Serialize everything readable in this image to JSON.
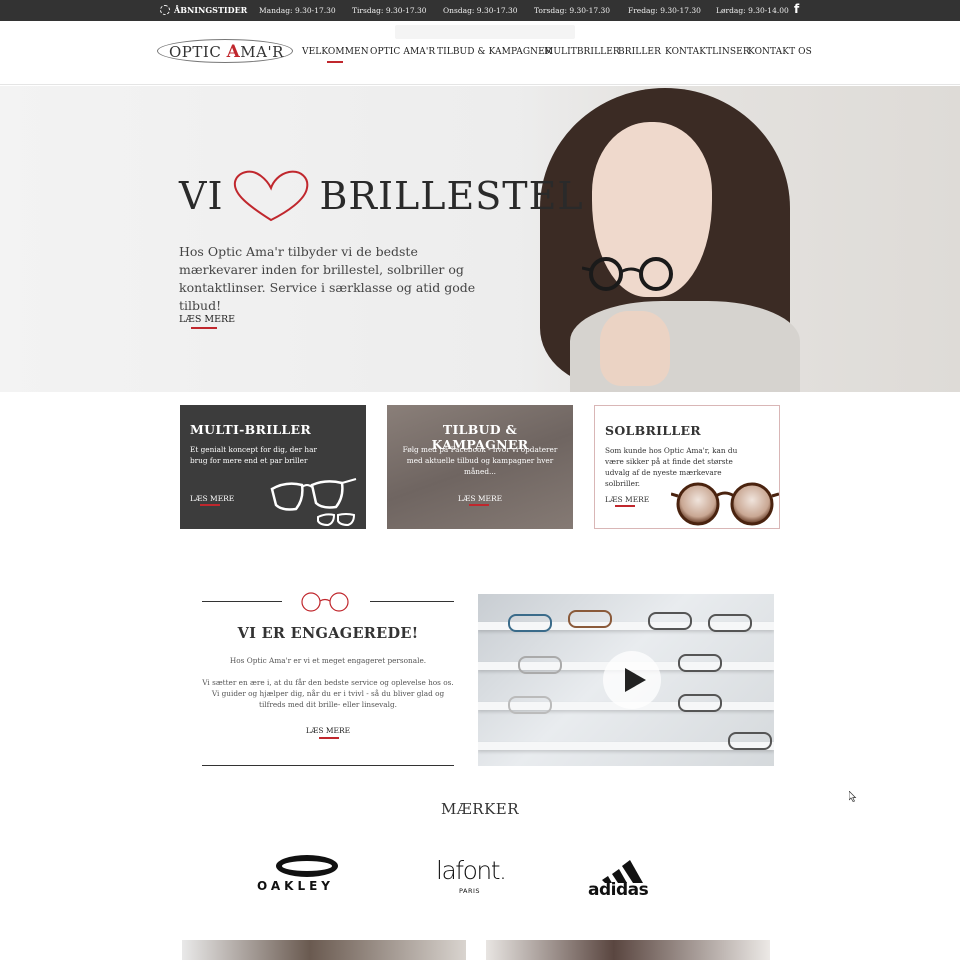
{
  "topbar": {
    "hours_label": "ÅBNINGSTIDER",
    "days": [
      {
        "text": "Mandag: 9.30-17.30"
      },
      {
        "text": "Tirsdag: 9.30-17.30"
      },
      {
        "text": "Onsdag: 9.30-17.30"
      },
      {
        "text": "Torsdag: 9.30-17.30"
      },
      {
        "text": "Fredag: 9.30-17.30"
      },
      {
        "text": "Lørdag: 9.30-14.00"
      }
    ],
    "facebook_icon": "f"
  },
  "logo": {
    "text_before": "OPTIC ",
    "text_accent": "A",
    "text_after": "MA'R"
  },
  "nav": {
    "items": [
      {
        "label": "VELKOMMEN"
      },
      {
        "label": "OPTIC AMA'R"
      },
      {
        "label": "TILBUD & KAMPAGNER"
      },
      {
        "label": "MULITBRILLER"
      },
      {
        "label": "BRILLER"
      },
      {
        "label": "KONTAKTLINSER"
      },
      {
        "label": "KONTAKT OS"
      }
    ]
  },
  "hero": {
    "title_left": "VI",
    "title_right": "BRILLESTEL",
    "text": "Hos Optic Ama'r tilbyder vi de bedste mærkevarer inden for brillestel, solbriller og kontaktlinser. Service i særklasse og atid gode tilbud!",
    "more": "LÆS MERE"
  },
  "cards": [
    {
      "title": "MULTI-BRILLER",
      "desc": "Et genialt koncept for dig, der har brug for mere end et par briller",
      "more": "LÆS MERE"
    },
    {
      "title": "TILBUD & KAMPAGNER",
      "desc": "Følg med på Facebook - hvor vi opdaterer med aktuelle tilbud og kampagner hver måned...",
      "more": "LÆS MERE"
    },
    {
      "title": "SOLBRILLER",
      "desc": "Som kunde hos Optic Ama'r, kan du være sikker på at finde det største udvalg af de nyeste mærkevare solbriller.",
      "more": "LÆS MERE"
    }
  ],
  "engaged": {
    "title": "VI ER ENGAGEREDE!",
    "p1": "Hos Optic Ama'r er vi et meget engageret personale.",
    "p2": "Vi sætter en ære i, at du får den bedste service og oplevelse hos os. Vi guider og hjælper dig, når du er i tvivl - så du bliver glad og tilfreds med dit brille- eller linsevalg.",
    "more": "LÆS MERE"
  },
  "brands": {
    "title": "MÆRKER",
    "oakley": "OAKLEY",
    "lafont": "lafont.",
    "lafont_sub": "PARIS",
    "adidas": "adidas"
  },
  "colors": {
    "accent": "#c0272d",
    "topbar": "#333333",
    "card_dark": "#3c3c3c"
  }
}
